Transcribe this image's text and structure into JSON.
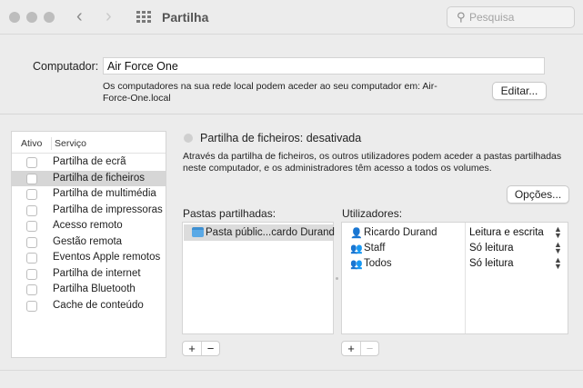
{
  "window": {
    "title": "Partilha",
    "search_placeholder": "Pesquisa",
    "icons": [
      "back-arrow-icon",
      "forward-arrow-icon",
      "grid-icon",
      "search-icon"
    ]
  },
  "computer": {
    "label": "Computador:",
    "name": "Air Force One",
    "note": "Os computadores na sua rede local podem aceder ao seu computador em: Air-Force-One.local",
    "edit_button": "Editar..."
  },
  "services": {
    "header_on": "Ativo",
    "header_service": "Serviço",
    "items": [
      {
        "label": "Partilha de ecrã",
        "checked": false,
        "selected": false
      },
      {
        "label": "Partilha de ficheiros",
        "checked": false,
        "selected": true
      },
      {
        "label": "Partilha de multimédia",
        "checked": false,
        "selected": false
      },
      {
        "label": "Partilha de impressoras",
        "checked": false,
        "selected": false
      },
      {
        "label": "Acesso remoto",
        "checked": false,
        "selected": false
      },
      {
        "label": "Gestão remota",
        "checked": false,
        "selected": false
      },
      {
        "label": "Eventos Apple remotos",
        "checked": false,
        "selected": false
      },
      {
        "label": "Partilha de internet",
        "checked": false,
        "selected": false
      },
      {
        "label": "Partilha Bluetooth",
        "checked": false,
        "selected": false
      },
      {
        "label": "Cache de conteúdo",
        "checked": false,
        "selected": false
      }
    ]
  },
  "detail": {
    "status": "Partilha de ficheiros: desativada",
    "description": "Através da partilha de ficheiros, os outros utilizadores podem aceder a pastas partilhadas neste computador, e os administradores têm acesso a todos os volumes.",
    "options_button": "Opções...",
    "folders_label": "Pastas partilhadas:",
    "folders": [
      "Pasta públic...cardo Durand"
    ],
    "users_label": "Utilizadores:",
    "users": [
      {
        "name": "Ricardo Durand",
        "permission": "Leitura e escrita",
        "icon": "single-user-icon"
      },
      {
        "name": "Staff",
        "permission": "Só leitura",
        "icon": "group-icon"
      },
      {
        "name": "Todos",
        "permission": "Só leitura",
        "icon": "group-icon"
      }
    ],
    "add_label": "+",
    "remove_label": "−"
  },
  "colors": {
    "selected_row": "#d6d6d6",
    "window_bg": "#ececec",
    "folder_blue": "#5aa9e6"
  }
}
